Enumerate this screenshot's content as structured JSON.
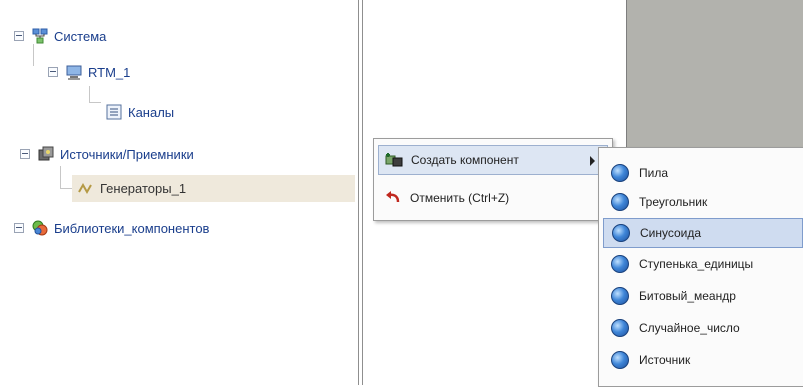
{
  "tree": {
    "root_system": "Система",
    "rtm_node": "RTM_1",
    "channels_node": "Каналы",
    "sources_node": "Источники/Приемники",
    "generators_node": "Генераторы_1",
    "libraries_node": "Библиотеки_компонентов"
  },
  "context_menu": {
    "create_component": "Создать компонент",
    "cancel": "Отменить (Ctrl+Z)"
  },
  "submenu": {
    "items": [
      "Пила",
      "Треугольник",
      "Синусоида",
      "Ступенька_единицы",
      "Битовый_меандр",
      "Случайное_число",
      "Источник"
    ]
  },
  "colors": {
    "tree_text": "#1a3e8c",
    "menu_highlight": "#cfdcf0",
    "right_pane_bg": "#b2b2ad"
  }
}
